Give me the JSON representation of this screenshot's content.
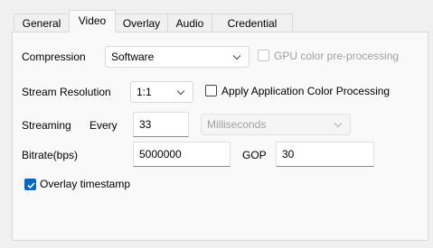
{
  "tabs": [
    {
      "label": "General",
      "active": false
    },
    {
      "label": "Video",
      "active": true
    },
    {
      "label": "Overlay",
      "active": false
    },
    {
      "label": "Audio",
      "active": false
    },
    {
      "label": "Credential",
      "active": false
    }
  ],
  "compression": {
    "label": "Compression",
    "value": "Software",
    "gpu_label": "GPU color pre-processing",
    "gpu_checked": false,
    "gpu_enabled": false
  },
  "resolution": {
    "label": "Stream Resolution",
    "value": "1:1",
    "apply_color_label": "Apply Application Color Processing",
    "apply_color_checked": false
  },
  "streaming": {
    "label": "Streaming",
    "every_label": "Every",
    "interval": "33",
    "unit": "Milliseconds"
  },
  "bitrate": {
    "label": "Bitrate(bps)",
    "value": "5000000",
    "gop_label": "GOP",
    "gop_value": "30"
  },
  "overlay": {
    "label": "Overlay timestamp",
    "checked": true
  },
  "colors": {
    "accent": "#0067c0",
    "background": "#f0f0f0",
    "panel": "#f9f9f9"
  }
}
